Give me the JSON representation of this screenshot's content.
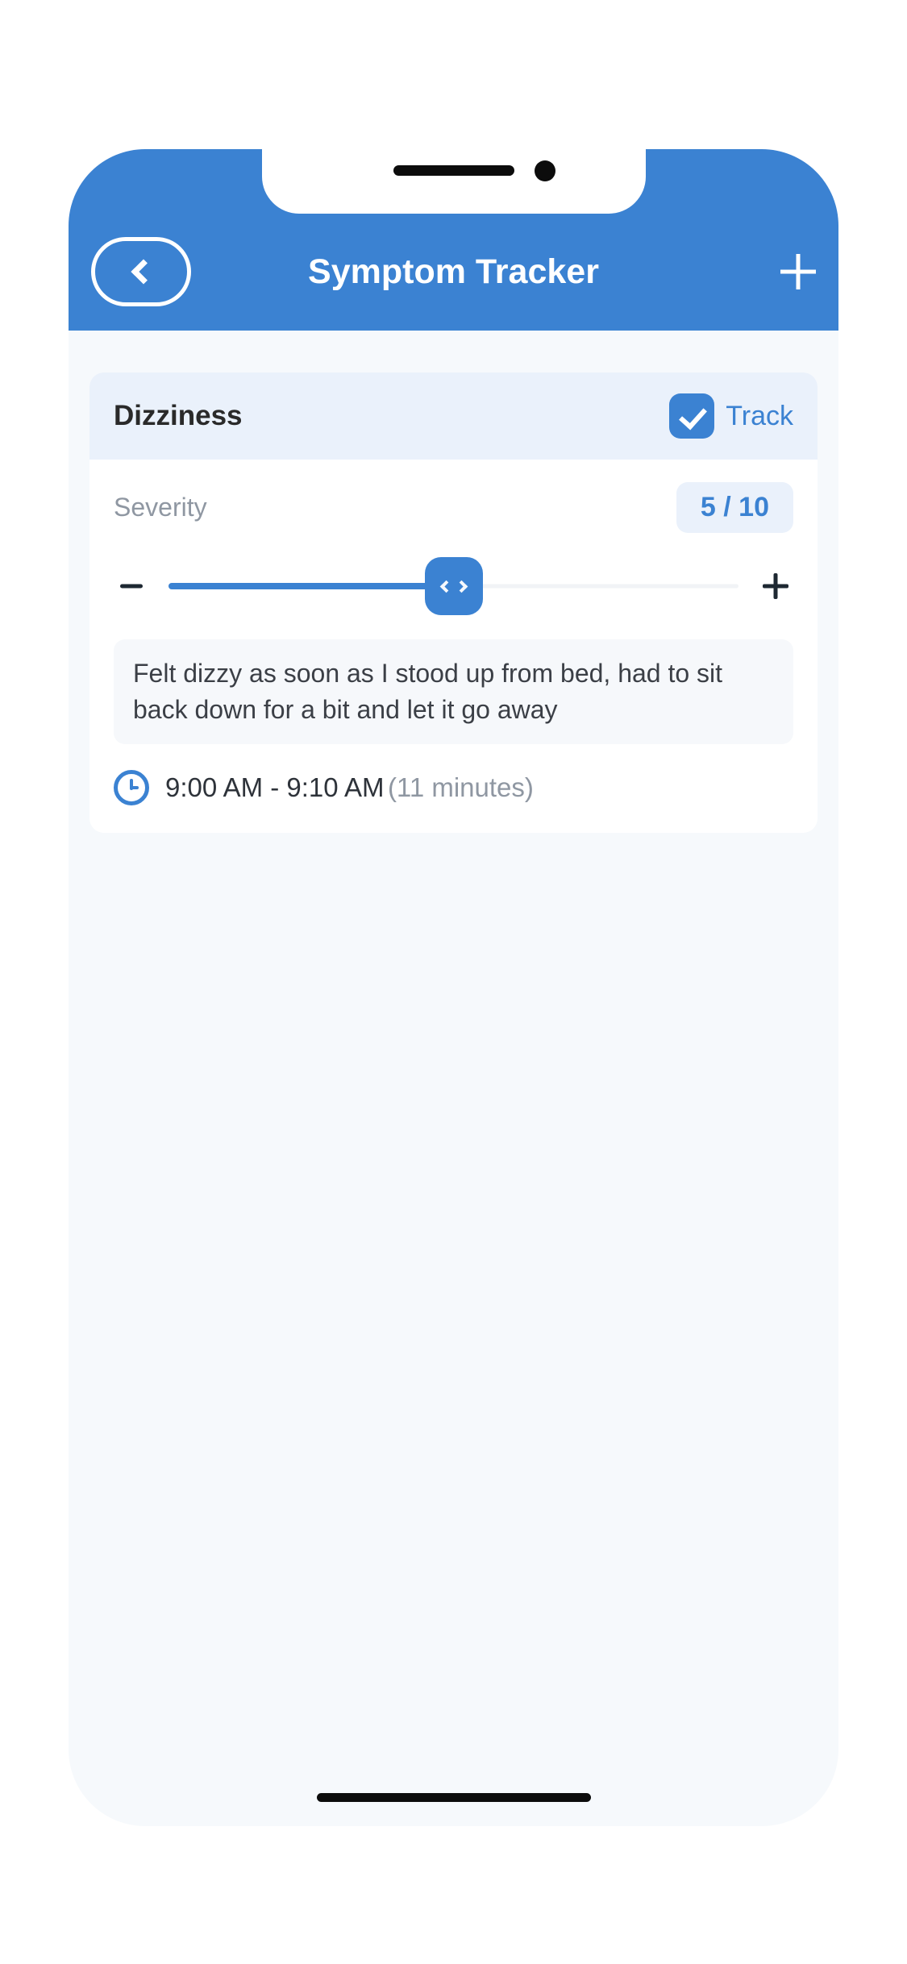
{
  "header": {
    "title": "Symptom Tracker"
  },
  "card": {
    "symptom_name": "Dizziness",
    "track_label": "Track",
    "track_checked": true,
    "severity_label": "Severity",
    "severity_value": 5,
    "severity_max": 10,
    "severity_badge": "5 / 10",
    "note": "Felt dizzy as soon as I stood up from bed, had to sit back down for a bit and let it go away",
    "time_range": "9:00 AM - 9:10 AM",
    "time_duration": "(11 minutes)"
  },
  "colors": {
    "brand": "#3b82d2"
  }
}
